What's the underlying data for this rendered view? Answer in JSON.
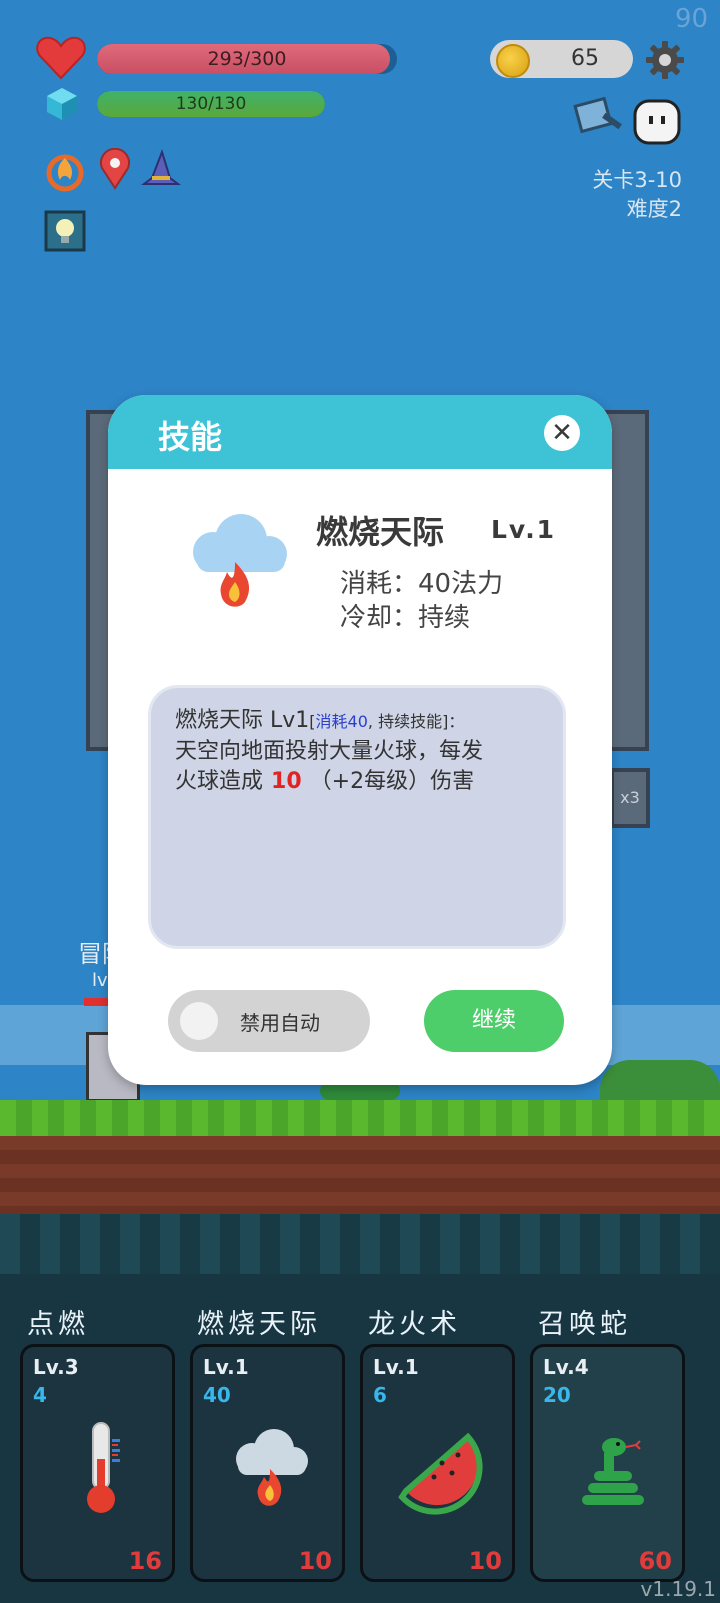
{
  "hud": {
    "fps": "90",
    "hp": {
      "text": "293/300",
      "value": 293,
      "max": 300
    },
    "mp": {
      "text": "130/130",
      "value": 130,
      "max": 130
    },
    "coins": "65",
    "stage": "关卡3-10",
    "difficulty": "难度2",
    "buff_icons": [
      "fire-ring-icon",
      "map-pin-icon",
      "wizard-hat-icon",
      "lightbulb-icon"
    ]
  },
  "scene": {
    "hero_name": "冒险",
    "hero_level": "lv",
    "panel_badge": "x3"
  },
  "dialog": {
    "title": "技能",
    "close_label": "✕",
    "skill": {
      "name": "燃烧天际",
      "level": "Lv.1",
      "cost_line": "消耗：40法力",
      "cooldown_line": "冷却：持续"
    },
    "description": {
      "head": "燃烧天际 Lv1",
      "tag_open": "[",
      "tag_cost": "消耗40",
      "tag_rest": ", 持续技能]：",
      "line1": "天空向地面投射大量火球，每发",
      "line2_pre": "火球造成",
      "damage": "10",
      "line2_post": "（+2每级）伤害"
    },
    "auto_toggle_label": "禁用自动",
    "continue_label": "继续"
  },
  "skills": [
    {
      "title": "点燃",
      "level": "Lv.3",
      "cost": "4",
      "count": "16",
      "icon": "thermometer-icon"
    },
    {
      "title": "燃烧天际",
      "level": "Lv.1",
      "cost": "40",
      "count": "10",
      "icon": "fire-cloud-icon"
    },
    {
      "title": "龙火术",
      "level": "Lv.1",
      "cost": "6",
      "count": "10",
      "icon": "watermelon-icon"
    },
    {
      "title": "召唤蛇",
      "level": "Lv.4",
      "cost": "20",
      "count": "60",
      "icon": "snake-icon"
    }
  ],
  "version": "v1.19.1",
  "colors": {
    "sky": "#2d84c6",
    "dialog_header": "#3ec3d6",
    "continue": "#4ecd6b",
    "damage": "#e32222"
  }
}
